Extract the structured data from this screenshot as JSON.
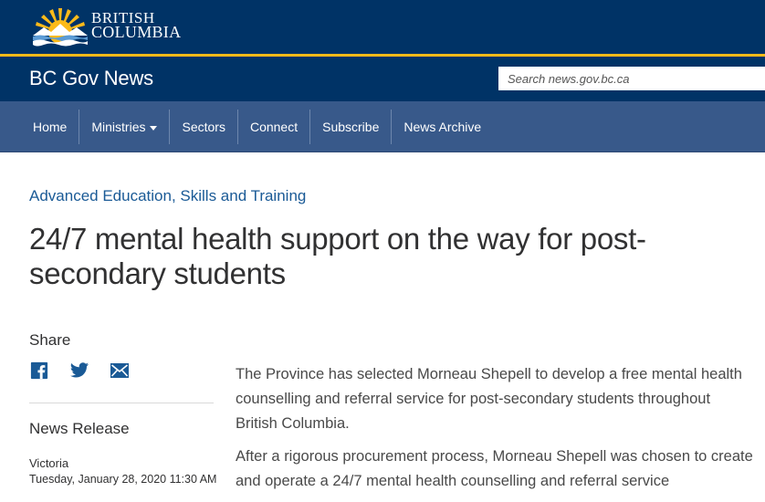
{
  "header": {
    "logo_line1": "BRITISH",
    "logo_line2": "COLUMBIA",
    "site_title": "BC Gov News",
    "search_placeholder": "Search news.gov.bc.ca"
  },
  "nav": {
    "items": [
      {
        "label": "Home"
      },
      {
        "label": "Ministries",
        "has_dropdown": true
      },
      {
        "label": "Sectors"
      },
      {
        "label": "Connect"
      },
      {
        "label": "Subscribe"
      },
      {
        "label": "News Archive"
      }
    ]
  },
  "article": {
    "ministry": "Advanced Education, Skills and Training",
    "title": "24/7 mental health support on the way for post-secondary students",
    "share_label": "Share",
    "type_label": "News Release",
    "location": "Victoria",
    "datetime": "Tuesday, January 28, 2020 11:30 AM",
    "paragraphs": [
      "The Province has selected Morneau Shepell to develop a free mental health counselling and referral service for post-secondary students throughout British Columbia.",
      "After a rigorous procurement process, Morneau Shepell was chosen to create and operate a 24/7 mental health counselling and referral service"
    ]
  },
  "social_icons": [
    "facebook-icon",
    "twitter-icon",
    "email-icon"
  ],
  "colors": {
    "header_bg": "#003366",
    "accent_gold": "#fcba19",
    "nav_bg": "#38598a",
    "link": "#1a5a96"
  }
}
